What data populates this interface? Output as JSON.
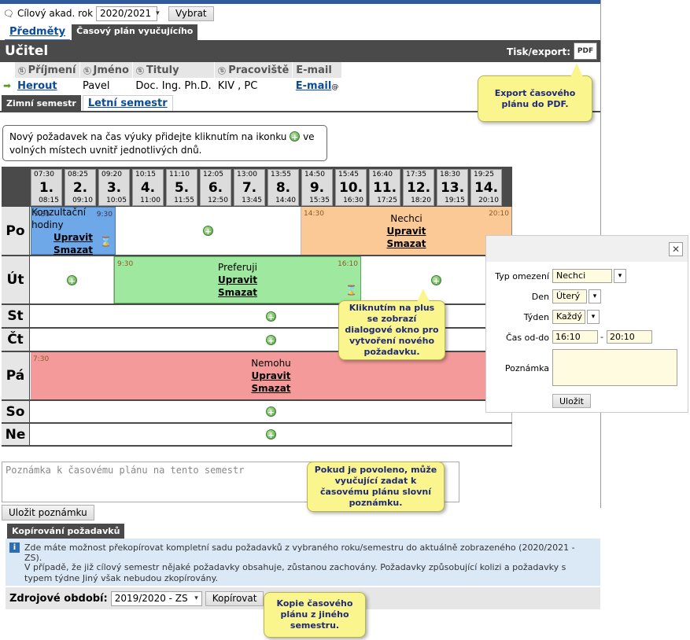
{
  "toolbar": {
    "year_label": "Cílový akad. rok",
    "year_value": "2020/2021",
    "select_button": "Vybrat"
  },
  "tabs": {
    "subjects": "Předměty",
    "schedule": "Časový plán vyučujícího"
  },
  "section": {
    "title": "Učitel",
    "print_label": "Tisk/export:",
    "pdf_label": "PDF"
  },
  "teacher_table": {
    "headers": [
      "Příjmení",
      "Jméno",
      "Tituly",
      "Pracoviště",
      "E-mail"
    ],
    "row": {
      "surname": "Herout",
      "name": "Pavel",
      "titles": "Doc. Ing. Ph.D.",
      "workplace": "KIV , PC",
      "email": "E-mail"
    }
  },
  "semester_tabs": {
    "winter": "Zimní semestr",
    "summer": "Letní semestr"
  },
  "hint": {
    "before": "Nový požadavek na čas výuky přidejte kliknutím na ikonku",
    "after": "ve volných místech uvnitř jednotlivých dnů."
  },
  "slots": [
    {
      "start": "07:30",
      "num": "1.",
      "end": "08:15"
    },
    {
      "start": "08:25",
      "num": "2.",
      "end": "09:10"
    },
    {
      "start": "09:20",
      "num": "3.",
      "end": "10:05"
    },
    {
      "start": "10:15",
      "num": "4.",
      "end": "11:00"
    },
    {
      "start": "11:10",
      "num": "5.",
      "end": "11:55"
    },
    {
      "start": "12:05",
      "num": "6.",
      "end": "12:50"
    },
    {
      "start": "13:00",
      "num": "7.",
      "end": "13:45"
    },
    {
      "start": "13:55",
      "num": "8.",
      "end": "14:40"
    },
    {
      "start": "14:50",
      "num": "9.",
      "end": "15:35"
    },
    {
      "start": "15:45",
      "num": "10.",
      "end": "16:30"
    },
    {
      "start": "16:40",
      "num": "11.",
      "end": "17:25"
    },
    {
      "start": "17:35",
      "num": "12.",
      "end": "18:20"
    },
    {
      "start": "18:30",
      "num": "13.",
      "end": "19:15"
    },
    {
      "start": "19:25",
      "num": "14.",
      "end": "20:10"
    }
  ],
  "days": [
    "Po",
    "Út",
    "St",
    "Čt",
    "Pá",
    "So",
    "Ne"
  ],
  "blocks": {
    "po1": {
      "start": "7:30",
      "end": "9:30",
      "title": "Konzultační hodiny",
      "edit": "Upravit",
      "delete": "Smazat",
      "color": "#6fa8e8"
    },
    "po2": {
      "start": "14:30",
      "end": "20:10",
      "title": "Nechci",
      "edit": "Upravit",
      "delete": "Smazat",
      "color": "#fbc996"
    },
    "ut1": {
      "start": "9:30",
      "end": "16:10",
      "title": "Preferuji",
      "edit": "Upravit",
      "delete": "Smazat",
      "color": "#9fe89f"
    },
    "pa1": {
      "start": "7:30",
      "title": "Nemohu",
      "edit": "Upravit",
      "delete": "Smazat",
      "color": "#f59a9a"
    }
  },
  "dialog": {
    "type_label": "Typ omezení",
    "type_value": "Nechci",
    "day_label": "Den",
    "day_value": "Úterý",
    "week_label": "Týden",
    "week_value": "Každý",
    "time_label": "Čas od-do",
    "time_from": "16:10",
    "time_dash": "-",
    "time_to": "20:10",
    "note_label": "Poznámka",
    "save": "Uložit"
  },
  "callouts": {
    "pdf": "Export časového plánu do PDF.",
    "plus": "Kliknutím na plus se zobrazí dialogové okno pro vytvoření nového požadavku.",
    "note": "Pokud je povoleno, může vyučující zadat k časovému plánu slovní poznámku.",
    "copy": "Kopie časového plánu z jiného semestru."
  },
  "note": {
    "placeholder": "Poznámka k časovému plánu na tento semestr",
    "save": "Uložit poznámku"
  },
  "copy": {
    "header": "Kopírování požadavků",
    "info1": "Zde máte možnost překopírovat kompletní sadu požadavků z vybraného roku/semestru do aktuálně zobrazeného (2020/2021 - ZS).",
    "info2": "V případě, že již cílový semestr nějaké požadavky obsahuje, zůstanou zachovány. Požadavky způsobující kolizi a požadavky s typem týdne Jiný však nebudou zkopírovány.",
    "source_label": "Zdrojové období:",
    "source_value": "2019/2020 - ZS",
    "copy_button": "Kopírovat"
  }
}
